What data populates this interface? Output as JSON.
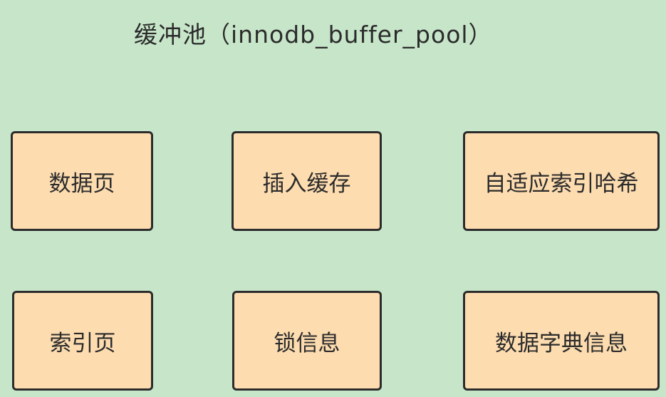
{
  "diagram": {
    "title": "缓冲池（innodb_buffer_pool）",
    "boxes": [
      {
        "label": "数据页"
      },
      {
        "label": "插入缓存"
      },
      {
        "label": "自适应索引哈希"
      },
      {
        "label": "索引页"
      },
      {
        "label": "锁信息"
      },
      {
        "label": "数据字典信息"
      }
    ],
    "colors": {
      "background": "#c7e6c9",
      "box_fill": "#fddcb0",
      "box_border": "#2c2c2c",
      "text": "#2b2b2b"
    }
  }
}
